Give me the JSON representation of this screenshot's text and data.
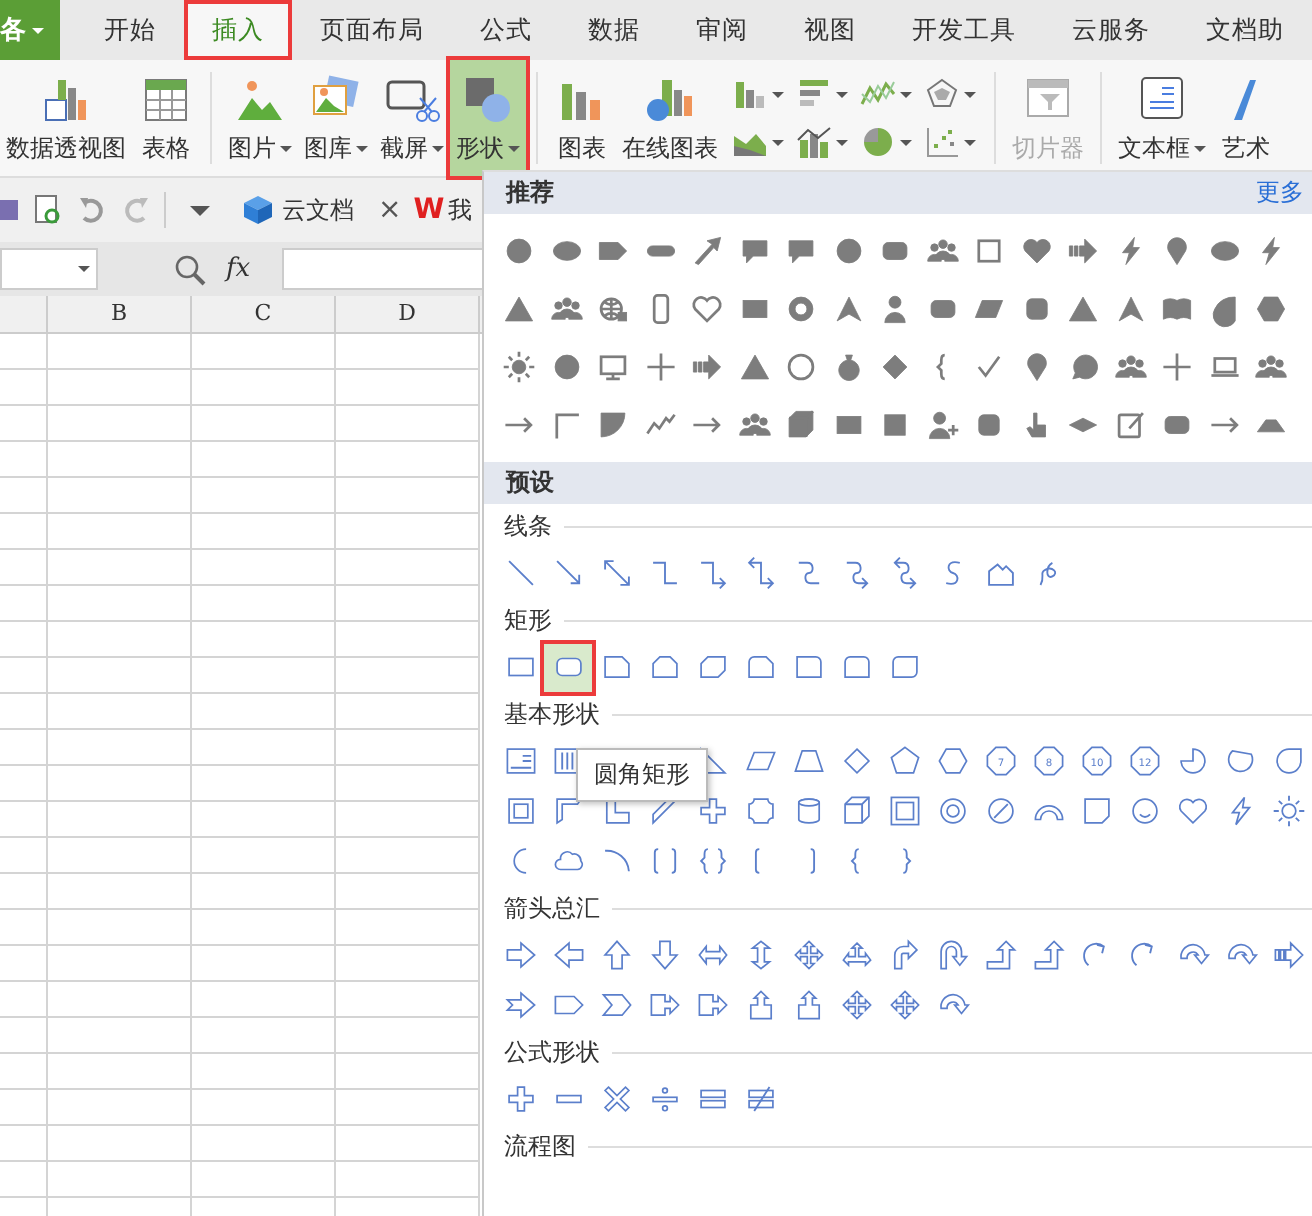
{
  "app_menu": {
    "label": "各"
  },
  "tabs": [
    {
      "label": "开始",
      "selected": false,
      "highlighted": false
    },
    {
      "label": "插入",
      "selected": true,
      "highlighted": true
    },
    {
      "label": "页面布局",
      "selected": false,
      "highlighted": false
    },
    {
      "label": "公式",
      "selected": false,
      "highlighted": false
    },
    {
      "label": "数据",
      "selected": false,
      "highlighted": false
    },
    {
      "label": "审阅",
      "selected": false,
      "highlighted": false
    },
    {
      "label": "视图",
      "selected": false,
      "highlighted": false
    },
    {
      "label": "开发工具",
      "selected": false,
      "highlighted": false
    },
    {
      "label": "云服务",
      "selected": false,
      "highlighted": false
    },
    {
      "label": "文档助",
      "selected": false,
      "highlighted": false
    }
  ],
  "ribbon": {
    "groups": [
      {
        "buttons": [
          {
            "label": "数据透视图",
            "has_menu": false,
            "selected": false,
            "disabled": false
          },
          {
            "label": "表格",
            "has_menu": false,
            "selected": false,
            "disabled": false
          }
        ]
      },
      {
        "buttons": [
          {
            "label": "图片",
            "has_menu": true,
            "selected": false,
            "disabled": false
          },
          {
            "label": "图库",
            "has_menu": true,
            "selected": false,
            "disabled": false
          },
          {
            "label": "截屏",
            "has_menu": true,
            "selected": false,
            "disabled": false
          },
          {
            "label": "形状",
            "has_menu": true,
            "selected": true,
            "disabled": false,
            "highlighted": true
          }
        ]
      },
      {
        "buttons": [
          {
            "label": "图表",
            "has_menu": false,
            "selected": false,
            "disabled": false
          },
          {
            "label": "在线图表",
            "has_menu": false,
            "selected": false,
            "disabled": false
          }
        ]
      },
      {
        "buttons": [
          {
            "label": "切片器",
            "has_menu": false,
            "selected": false,
            "disabled": true
          }
        ]
      },
      {
        "buttons": [
          {
            "label": "文本框",
            "has_menu": true,
            "selected": false,
            "disabled": false
          },
          {
            "label": "艺术",
            "has_menu": false,
            "selected": false,
            "disabled": false
          }
        ]
      }
    ]
  },
  "quick_bar": {
    "doc_tabs": [
      {
        "label": "云文档",
        "close": "×"
      },
      {
        "label": "我",
        "logo": "W"
      }
    ]
  },
  "formula_bar": {
    "function_label": "fx"
  },
  "sheet": {
    "columns": [
      "B",
      "C",
      "D"
    ]
  },
  "shape_panel": {
    "recommended": {
      "title": "推荐",
      "more_link": "更多"
    },
    "presets": {
      "title": "预设",
      "sections": [
        {
          "title": "线条"
        },
        {
          "title": "矩形",
          "shapes": [
            {
              "selected": false,
              "highlighted": false
            },
            {
              "selected": true,
              "highlighted": true
            },
            {
              "selected": false,
              "highlighted": false
            },
            {
              "selected": false,
              "highlighted": false
            },
            {
              "selected": false,
              "highlighted": false
            },
            {
              "selected": false,
              "highlighted": false
            },
            {
              "selected": false,
              "highlighted": false
            },
            {
              "selected": false,
              "highlighted": false
            },
            {
              "selected": false,
              "highlighted": false
            }
          ]
        },
        {
          "title": "基本形状",
          "number_marks": [
            "7",
            "8",
            "10",
            "12"
          ],
          "tooltip": "圆角矩形"
        },
        {
          "title": "箭头总汇"
        },
        {
          "title": "公式形状"
        },
        {
          "title": "流程图"
        }
      ]
    }
  }
}
